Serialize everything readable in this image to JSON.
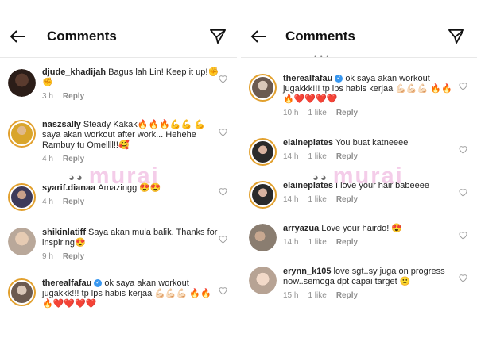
{
  "watermark": "murai",
  "left": {
    "title": "Comments",
    "comments": [
      {
        "user": "djude_khadijah",
        "text": "Bagus lah Lin! Keep it up!✊✊",
        "time": "3 h",
        "likes": "",
        "reply": "Reply"
      },
      {
        "user": "naszsally",
        "text": "Steady Kakak🔥🔥🔥💪💪 💪 saya akan workout after work... Hehehe Rambuy tu Omellll!!🥰",
        "time": "4 h",
        "likes": "",
        "reply": "Reply"
      },
      {
        "user": "syarif.dianaa",
        "text": "Amazingg 😍😍",
        "time": "4 h",
        "likes": "",
        "reply": "Reply"
      },
      {
        "user": "shikinlatiff",
        "text": "Saya akan mula balik. Thanks for inspiring😍",
        "time": "9 h",
        "likes": "",
        "reply": "Reply"
      },
      {
        "user": "therealfafau",
        "text": "ok saya akan workout jugakkk!!! tp lps habis kerjaa 💪🏻💪🏻💪🏻 🔥🔥🔥❤️❤️❤️❤️",
        "time": "",
        "likes": "",
        "reply": ""
      }
    ]
  },
  "right": {
    "title": "Comments",
    "dots": "• • •",
    "comments": [
      {
        "user": "therealfafau",
        "text": "ok saya akan workout jugakkk!!! tp lps habis kerjaa 💪🏻💪🏻💪🏻 🔥🔥🔥❤️❤️❤️❤️",
        "time": "10 h",
        "likes": "1 like",
        "reply": "Reply"
      },
      {
        "user": "elaineplates",
        "text": "You buat katneeee",
        "time": "14 h",
        "likes": "1 like",
        "reply": "Reply"
      },
      {
        "user": "elaineplates",
        "text": "I love your hair babeeee",
        "time": "14 h",
        "likes": "1 like",
        "reply": "Reply"
      },
      {
        "user": "arryazua",
        "text": "Love your hairdo! 😍",
        "time": "14 h",
        "likes": "1 like",
        "reply": "Reply"
      },
      {
        "user": "erynn_k105",
        "text": "love sgt..sy juga on progress now..semoga dpt capai target 🙂",
        "time": "15 h",
        "likes": "1 like",
        "reply": "Reply"
      }
    ]
  },
  "colors": {
    "accent_ring": "#e2a02d",
    "verified": "#3897f0",
    "watermark": "#f3c5e6",
    "meta": "#8e8e8e"
  },
  "icons": {
    "back": "arrow-left-icon",
    "send": "paper-plane-icon",
    "like": "heart-outline-icon"
  }
}
